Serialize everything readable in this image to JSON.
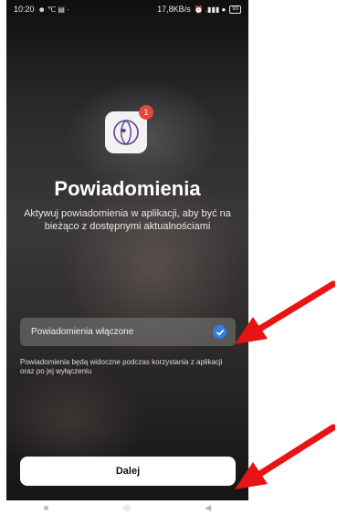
{
  "status_bar": {
    "time": "10:20",
    "left_icons": "☻ ℃ ▤ ·",
    "network_speed": "17,8KB/s",
    "right_icons": "⏰ .▮▮▮ ●",
    "battery": "93"
  },
  "app": {
    "icon": "app-logo-icon",
    "badge_count": "1",
    "title": "Powiadomienia",
    "subtitle": "Aktywuj powiadomienia w aplikacji, aby być na bieżąco z dostępnymi aktualnościami",
    "toggle": {
      "label": "Powiadomienia włączone",
      "checked": true,
      "accent_color": "#2f7fe0"
    },
    "note": "Powiadomienia będą widoczne podczas korzystania z aplikacji oraz po jej wyłączeniu",
    "next_button_label": "Dalej"
  },
  "nav_bar": {
    "recent": "■",
    "home": "◎",
    "back": "◀"
  },
  "annotations": {
    "arrow_color": "#e81414"
  }
}
